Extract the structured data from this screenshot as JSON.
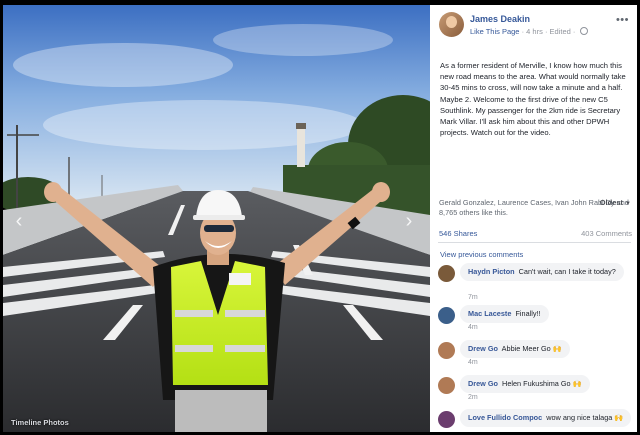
{
  "photo": {
    "caption": "Timeline Photos",
    "prev_arrow": "‹",
    "next_arrow": "›"
  },
  "header": {
    "author": "James Deakin",
    "like_page": "Like This Page",
    "time": "4 hrs",
    "edited": "Edited",
    "more": "•••"
  },
  "post": {
    "text": "As a former resident of Merville, I know how much this new road means to the area. What would normally take 30-45 mins to cross, will now take a minute and a half. Maybe 2. Welcome to the first drive of the new C5 Southlink. My passenger for the 2km ride is Secretary Mark Villar. I'll ask him about this and other DPWH projects. Watch out for the video."
  },
  "reactions": {
    "likes_text": "Gerald Gonzalez, Laurence Cases, Ivan John Rabi Dy and 8,765 others like this.",
    "sort": "Oldest",
    "shares": "546 Shares",
    "comments_count": "403 Comments"
  },
  "comments": {
    "view_previous": "View previous comments",
    "items": [
      {
        "name": "Haydn Picton",
        "text": "Can't wait, can I take it today?",
        "time": "7m",
        "avatar_color": "#7a5a3a"
      },
      {
        "name": "Mac Laceste",
        "text": "Finally!!",
        "time": "4m",
        "avatar_color": "#3b5f8a"
      },
      {
        "name": "Drew Go",
        "text": "Abbie Meer Go",
        "emoji": "🙌",
        "time": "4m",
        "avatar_color": "#b07a55"
      },
      {
        "name": "Drew Go",
        "text": "Helen Fukushima Go",
        "emoji": "🙌",
        "time": "2m",
        "avatar_color": "#b07a55"
      },
      {
        "name": "Love Fullido Compoc",
        "text": "wow ang nice talaga",
        "emoji": "🙌",
        "avatar_color": "#6b3d6e"
      }
    ]
  },
  "colors": {
    "link": "#365899",
    "vest": "#c6f01e",
    "sky_top": "#3d73c4",
    "road": "#3a3a3c"
  }
}
